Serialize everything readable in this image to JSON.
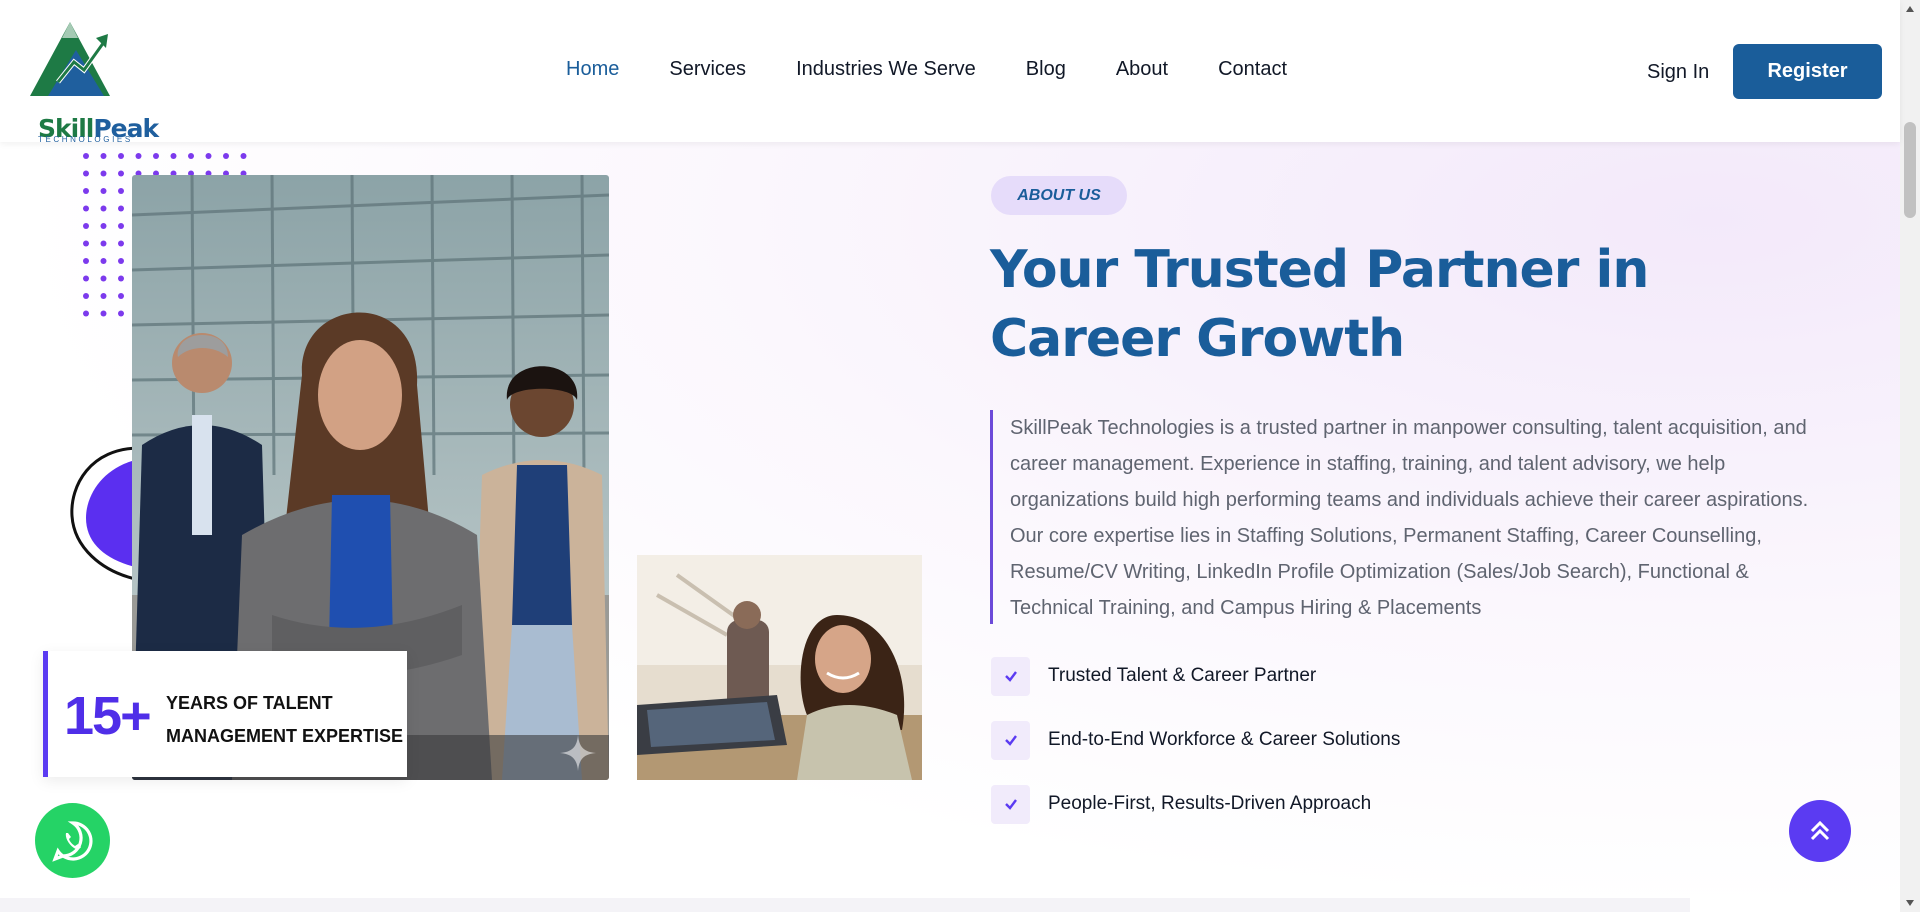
{
  "header": {
    "logo": {
      "word_a": "Skill",
      "word_b": "Peak",
      "sub": "TECHNOLOGIES"
    },
    "nav": [
      {
        "label": "Home",
        "active": true
      },
      {
        "label": "Services",
        "active": false
      },
      {
        "label": "Industries We Serve",
        "active": false
      },
      {
        "label": "Blog",
        "active": false
      },
      {
        "label": "About",
        "active": false
      },
      {
        "label": "Contact",
        "active": false
      }
    ],
    "signin_label": "Sign In",
    "register_label": "Register"
  },
  "about": {
    "badge": "ABOUT US",
    "title": "Your Trusted Partner in Career Growth",
    "description": "SkillPeak Technologies is a trusted partner in manpower consulting, talent acquisition, and career management. Experience in staffing, training, and talent advisory, we help organizations build high performing teams and individuals achieve their career aspirations. Our core expertise lies in Staffing Solutions, Permanent Staffing, Career Counselling, Resume/CV Writing, LinkedIn Profile Optimization (Sales/Job Search), Functional & Technical Training, and Campus Hiring & Placements",
    "features": [
      "Trusted Talent & Career Partner",
      "End-to-End Workforce & Career Solutions",
      "People-First, Results-Driven Approach"
    ]
  },
  "stat": {
    "number": "15+",
    "label": "YEARS OF TALENT MANAGEMENT EXPERTISE"
  },
  "icons": {
    "whatsapp": "whatsapp-icon",
    "back_to_top": "double-chevron-up-icon",
    "check": "check-icon"
  },
  "colors": {
    "brand_blue": "#1a5d9a",
    "accent_purple": "#5b3bf2",
    "whatsapp_green": "#25d366"
  }
}
